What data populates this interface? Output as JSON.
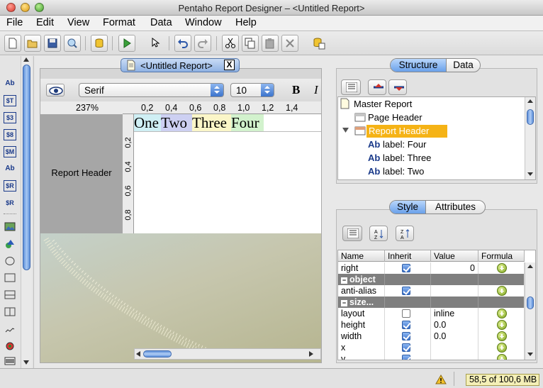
{
  "window": {
    "title": "Pentaho Report Designer – <Untitled Report>"
  },
  "menu": [
    "File",
    "Edit",
    "View",
    "Format",
    "Data",
    "Window",
    "Help"
  ],
  "toolbar_icons": [
    "new-icon",
    "open-icon",
    "save-icon",
    "preview-icon",
    "datasource-icon",
    "run-icon",
    "select-arrow-icon",
    "undo-icon",
    "redo-icon",
    "cut-icon",
    "copy-icon",
    "paste-icon",
    "delete-icon",
    "data-wizard-icon"
  ],
  "report_tab": {
    "label": "<Untitled Report>",
    "close": "X"
  },
  "format_bar": {
    "font_family": "Serif",
    "font_size": "10",
    "bold": "B",
    "italic": "I"
  },
  "canvas": {
    "zoom": "237%",
    "h_ruler": [
      "0,2",
      "0,4",
      "0,6",
      "0,8",
      "1,0",
      "1,2",
      "1,4"
    ],
    "v_ruler": [
      "0,2",
      "0,4",
      "0,6",
      "0,8"
    ],
    "section_label": "Report Header",
    "labels": [
      {
        "text": "One",
        "color": "#cfeff4"
      },
      {
        "text": "Two",
        "color": "#cdd0f2"
      },
      {
        "text": "Three",
        "color": "#fbf6c8"
      },
      {
        "text": "Four",
        "color": "#d2f2cd"
      }
    ]
  },
  "structure_panel": {
    "tabs": [
      "Structure",
      "Data"
    ],
    "active_tab": "Structure",
    "tree": [
      {
        "label": "Master Report",
        "icon": "report-icon"
      },
      {
        "label": "Page Header",
        "icon": "band-icon"
      },
      {
        "label": "Report Header",
        "icon": "band-icon",
        "selected": true,
        "expanded": true
      },
      {
        "label": "label: Four",
        "icon": "label-icon",
        "prefix": "Ab"
      },
      {
        "label": "label: Three",
        "icon": "label-icon",
        "prefix": "Ab"
      },
      {
        "label": "label: Two",
        "icon": "label-icon",
        "prefix": "Ab"
      }
    ]
  },
  "style_panel": {
    "tabs": [
      "Style",
      "Attributes"
    ],
    "active_tab": "Style",
    "columns": [
      "Name",
      "Inherit",
      "Value",
      "Formula"
    ],
    "rows": [
      {
        "name": "right",
        "inherit": true,
        "value": "0",
        "formula": true,
        "value_align": "right"
      },
      {
        "category": "object"
      },
      {
        "name": "anti-alias",
        "inherit": true,
        "value": "",
        "formula": true
      },
      {
        "category": "size..."
      },
      {
        "name": "layout",
        "inherit": false,
        "value": "inline",
        "formula": true
      },
      {
        "name": "height",
        "inherit": true,
        "value": "0.0",
        "formula": true
      },
      {
        "name": "width",
        "inherit": true,
        "value": "0.0",
        "formula": true
      },
      {
        "name": "x",
        "inherit": true,
        "value": "",
        "formula": true
      },
      {
        "name": "y",
        "inherit": true,
        "value": "",
        "formula": true
      }
    ]
  },
  "status": {
    "memory": "58,5 of 100,6 MB"
  },
  "palette_icons": [
    "label-icon",
    "text-field-icon",
    "number-field-icon",
    "date-field-icon",
    "message-field-icon",
    "resource-label-icon",
    "resource-field-icon",
    "resource-message-icon",
    "image-field-icon",
    "chart-icon",
    "ellipse-icon",
    "rectangle-icon",
    "horizontal-line-icon",
    "vertical-line-icon",
    "survey-scale-icon",
    "sparkline-icon",
    "barcode-icon"
  ]
}
